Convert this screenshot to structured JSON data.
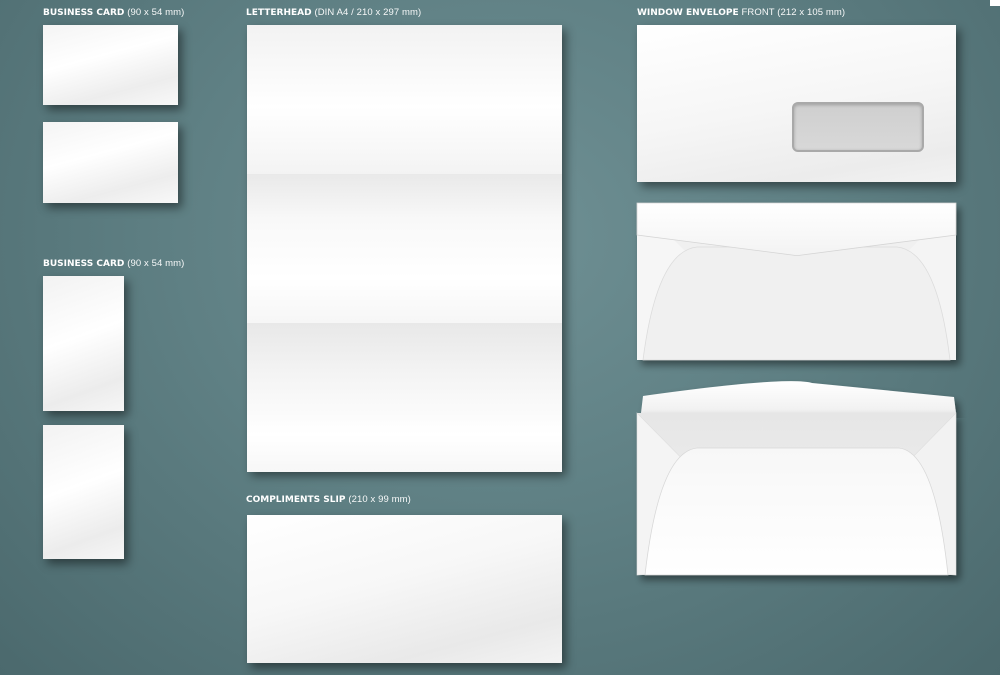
{
  "labels": {
    "card_h": {
      "title": "BUSINESS CARD",
      "spec": "(90 x 54 mm)"
    },
    "letterhead": {
      "title": "LETTERHEAD",
      "spec": "(DIN A4 / 210 x 297 mm)"
    },
    "envelope": {
      "title": "WINDOW ENVELOPE",
      "spec": "FRONT (212 x 105 mm)"
    },
    "card_v": {
      "title": "BUSINESS CARD",
      "spec": "(90 x 54 mm)"
    },
    "slip": {
      "title": "COMPLIMENTS SLIP",
      "spec": "(210 x 99 mm)"
    }
  },
  "colors": {
    "background": "#5f8084",
    "paper": "#f7f7f7",
    "label_text": "#ffffff",
    "window": "#d4d4d4"
  }
}
